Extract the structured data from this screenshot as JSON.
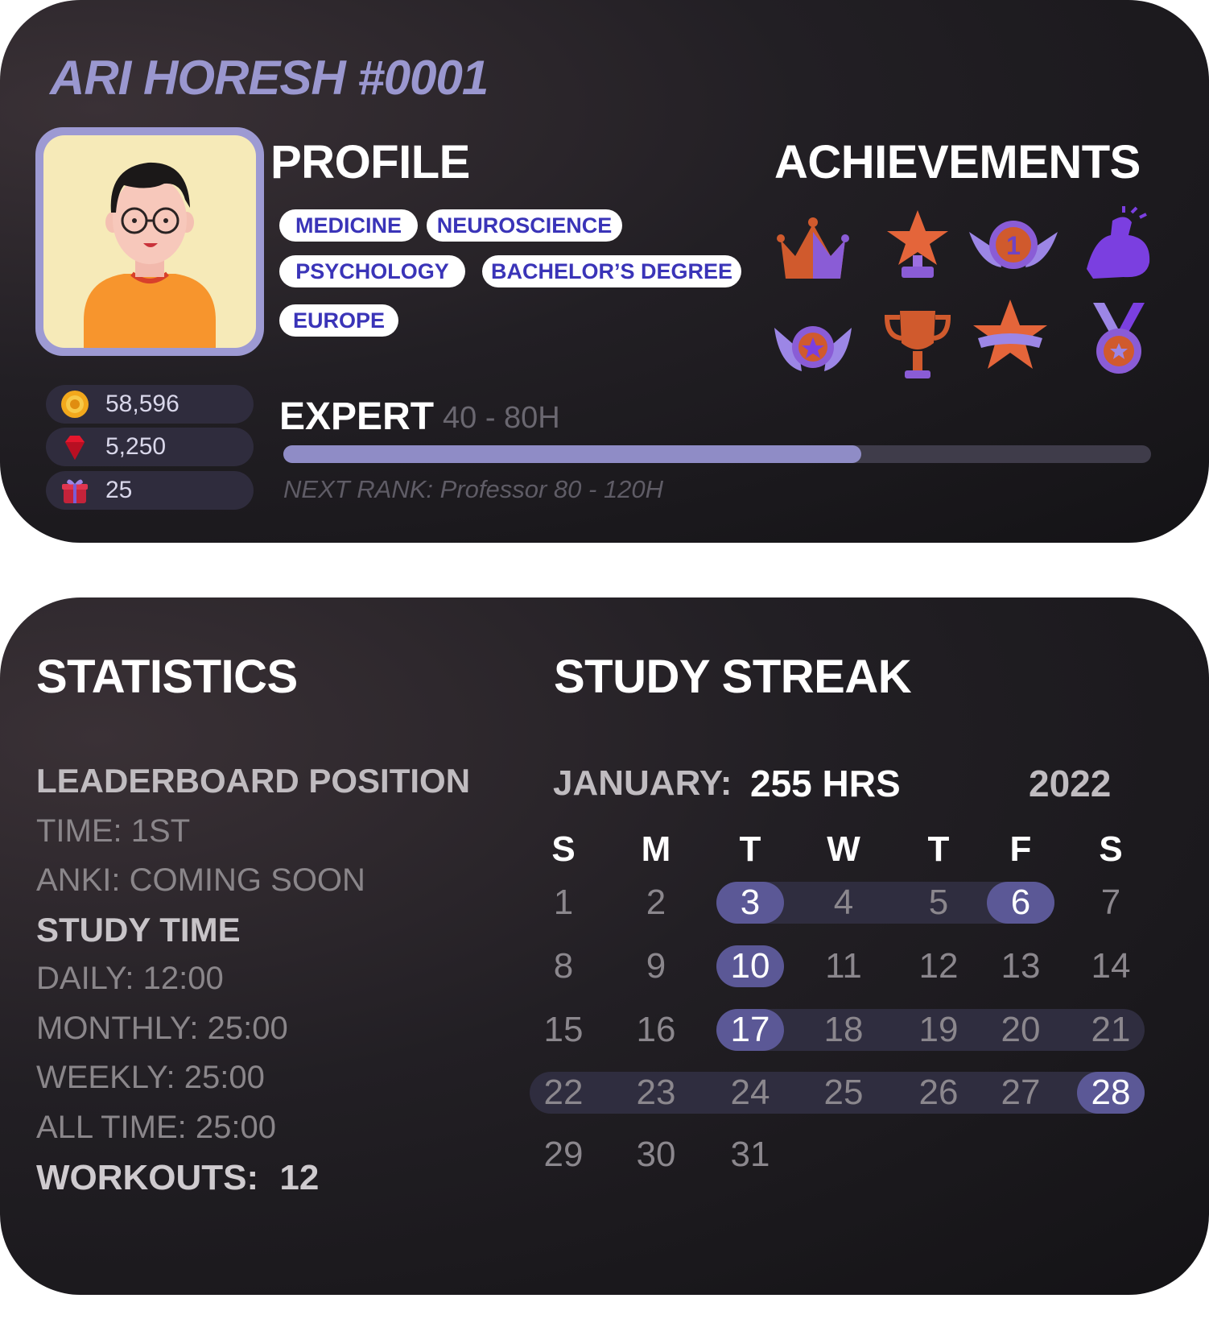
{
  "profile_card": {
    "player_name": "ARI HORESH #0001",
    "profile_title": "PROFILE",
    "achievements_title": "ACHIEVEMENTS",
    "tags": [
      "MEDICINE",
      "NEUROSCIENCE",
      "PSYCHOLOGY",
      "BACHELOR’S DEGREE",
      "EUROPE"
    ],
    "achievements": [
      "crown-icon",
      "star-trophy-icon",
      "first-place-wings-icon",
      "flexed-arm-icon",
      "winged-star-emblem-icon",
      "trophy-cup-icon",
      "star-banner-icon",
      "medal-icon"
    ],
    "currencies": [
      {
        "icon": "coin-icon",
        "value": "58,596"
      },
      {
        "icon": "gem-icon",
        "value": "5,250"
      },
      {
        "icon": "gift-icon",
        "value": "25"
      }
    ],
    "rank": "EXPERT",
    "rank_range": "40 - 80H",
    "rank_progress": 0.666,
    "next_rank": "NEXT RANK: Professor 80 - 120H"
  },
  "statistics": {
    "title": "STATISTICS",
    "leaderboard_heading": "LEADERBOARD POSITION",
    "time": "TIME: 1ST",
    "anki": "ANKI: COMING SOON",
    "study_time_heading": "STUDY TIME",
    "daily": "DAILY: 12:00",
    "monthly": "MONTHLY: 25:00",
    "weekly": "WEEKLY: 25:00",
    "all_time": "ALL TIME: 25:00",
    "workouts_label": "WORKOUTS:",
    "workouts_value": "12"
  },
  "study_streak": {
    "title": "STUDY STREAK",
    "month": "JANUARY:",
    "hours": "255 HRS",
    "year": "2022",
    "weekdays": [
      "S",
      "M",
      "T",
      "W",
      "T",
      "F",
      "S"
    ],
    "days": [
      [
        "1",
        "2",
        "3",
        "4",
        "5",
        "6",
        "7"
      ],
      [
        "8",
        "9",
        "10",
        "11",
        "12",
        "13",
        "14"
      ],
      [
        "15",
        "16",
        "17",
        "18",
        "19",
        "20",
        "21"
      ],
      [
        "22",
        "23",
        "24",
        "25",
        "26",
        "27",
        "28"
      ],
      [
        "29",
        "30",
        "31"
      ]
    ],
    "highlighted_days": [
      "3",
      "6",
      "10",
      "17",
      "28"
    ],
    "streak_ranges": [
      [
        "3",
        "6"
      ],
      [
        "17",
        "21"
      ],
      [
        "22",
        "28"
      ]
    ]
  },
  "colors": {
    "accent": "#9d9ad3",
    "tag_text": "#3a34b8",
    "highlight": "#5b5896",
    "band": "#2f2d3f"
  }
}
